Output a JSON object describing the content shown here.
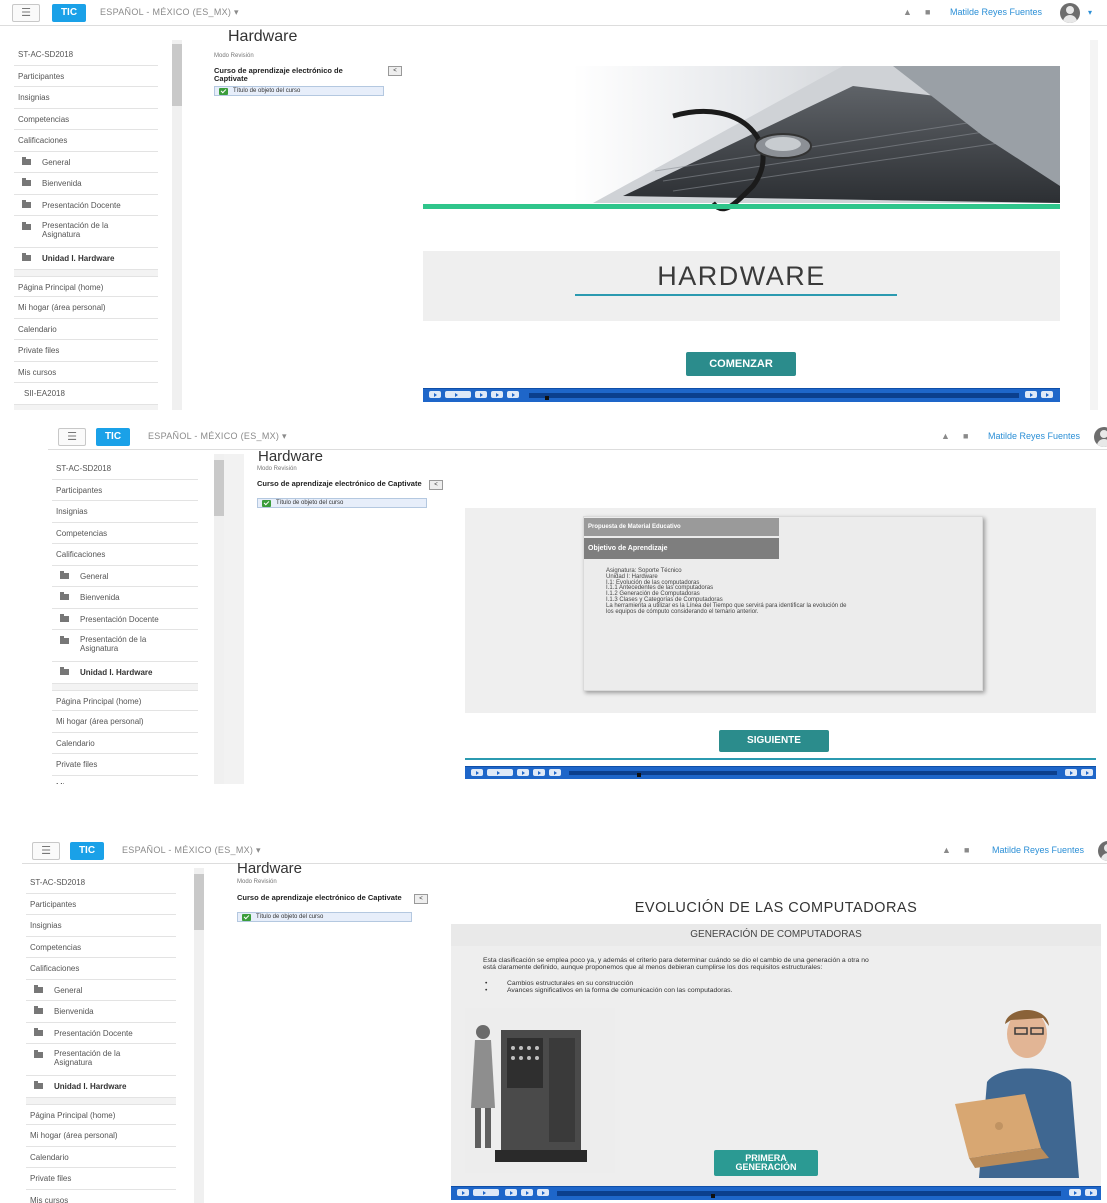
{
  "topbar": {
    "menu_glyph": "☰",
    "brand": "TIC",
    "language": "ESPAÑOL - MÉXICO (ES_MX) ▾",
    "icons": [
      "bell-icon",
      "chat-icon"
    ],
    "user_name": "Matilde Reyes Fuentes",
    "caret": "▾"
  },
  "sidebar": {
    "items": [
      {
        "label": "ST-AC-SD2018",
        "type": "link"
      },
      {
        "label": "Participantes",
        "type": "link"
      },
      {
        "label": "Insignias",
        "type": "link"
      },
      {
        "label": "Competencias",
        "type": "link"
      },
      {
        "label": "Calificaciones",
        "type": "link"
      },
      {
        "label": "General",
        "type": "folder"
      },
      {
        "label": "Bienvenida",
        "type": "folder"
      },
      {
        "label": "Presentación Docente",
        "type": "folder"
      },
      {
        "label": "Presentación de la Asignatura",
        "type": "folder"
      },
      {
        "label": "Unidad I. Hardware",
        "type": "folder"
      },
      {
        "label": "Página Principal (home)",
        "type": "link"
      },
      {
        "label": "Mi hogar (área personal)",
        "type": "link"
      },
      {
        "label": "Calendario",
        "type": "link"
      },
      {
        "label": "Private files",
        "type": "link"
      },
      {
        "label": "Mis cursos",
        "type": "link"
      },
      {
        "label": "SII-EA2018",
        "type": "link"
      }
    ]
  },
  "course": {
    "title": "Hardware",
    "mode": "Modo Revisión",
    "toc_title": "Curso de aprendizaje electrónico de Captivate",
    "toc_toggle": "<",
    "toc_item": "Título de objeto del curso"
  },
  "slide1": {
    "heading": "HARDWARE",
    "button": "COMENZAR",
    "accent": "#2fc58b"
  },
  "slide2": {
    "header_row1": "Propuesta de Material Educativo",
    "header_row2": "Objetivo de Aprendizaje",
    "body_lines": [
      "Asignatura: Soporte Técnico",
      "Unidad I: Hardware",
      "I.1: Evolución de las computadoras",
      "I.1.1 Antecedentes de las computadoras",
      "I.1.2 Generación de Computadoras",
      "I.1.3 Clases y Categorías de Computadoras",
      "La herramienta a utilizar es la Línea del Tiempo que servirá para identificar la evolución de",
      "los equipos de cómputo considerando el temario anterior."
    ],
    "button": "SIGUIENTE"
  },
  "slide3": {
    "title": "EVOLUCIÓN DE LAS COMPUTADORAS",
    "subtitle": "GENERACIÓN DE COMPUTADORAS",
    "paragraph_1": "Esta clasificación se emplea poco ya, y además el criterio para determinar cuándo se dio el cambio de una generación a otra no",
    "paragraph_2": "está claramente definido, aunque proponemos que al menos debieran cumplirse los dos requisitos estructurales:",
    "bullets": [
      "Cambios estructurales en su construcción",
      "Avances significativos en la forma de comunicación con las computadoras."
    ],
    "button_line1": "PRIMERA",
    "button_line2": "GENERACIÓN"
  },
  "colors": {
    "brand_blue": "#1aa1e8",
    "teal": "#2b8c8c",
    "control_bar": "#1e66c9",
    "user_link": "#2b8fd6"
  }
}
